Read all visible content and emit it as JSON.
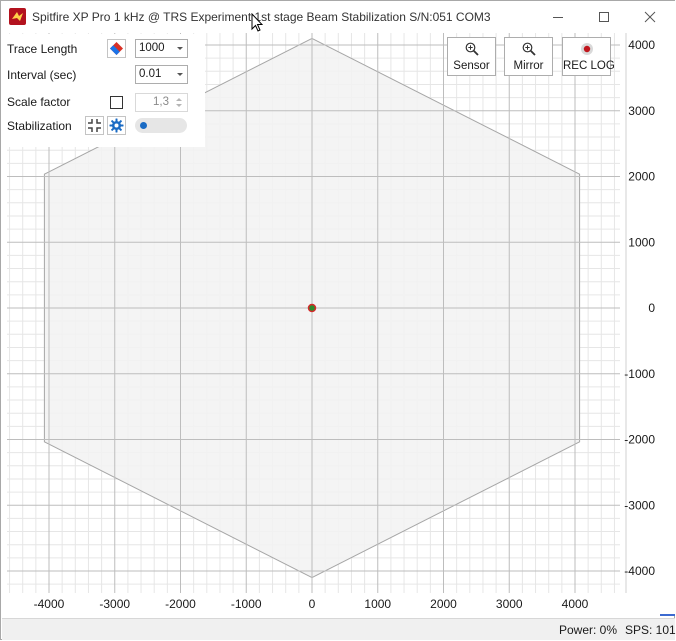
{
  "window": {
    "title": "Spitfire XP Pro 1 kHz @ TRS Experiment 1st stage Beam Stabilization  S/N:051  COM3",
    "app_icon": "spitfire-logo-icon",
    "buttons": {
      "minimize": "minimize-icon",
      "maximize": "maximize-icon",
      "close": "close-icon"
    }
  },
  "controls": {
    "trace_length": {
      "label": "Trace Length",
      "value": "1000",
      "icon": "clear-trace-eraser-icon"
    },
    "interval": {
      "label": "Interval (sec)",
      "value": "0.01"
    },
    "scale_factor": {
      "label": "Scale factor",
      "checked": false,
      "value": "1,3"
    },
    "stabilization": {
      "label": "Stabilization",
      "enabled": false,
      "icons": [
        "center-target-icon",
        "gear-icon"
      ]
    }
  },
  "toolbar": {
    "sensor": {
      "label": "Sensor",
      "icon": "zoom-in-icon"
    },
    "mirror": {
      "label": "Mirror",
      "icon": "zoom-in-icon"
    },
    "rec_log": {
      "label": "REC LOG",
      "icon": "record-icon"
    }
  },
  "status": {
    "power": "Power: 0%",
    "sps": "SPS: 101"
  },
  "colors": {
    "accent": "#1a6bc4",
    "hexagon_fill": "#f2f2f2",
    "point": "#2e8b2e",
    "point_outline": "#d42a2a",
    "app_icon": "#b3121e"
  },
  "chart_data": {
    "type": "scatter",
    "title": "",
    "xlabel": "",
    "ylabel": "",
    "xlim": [
      -4700,
      4700
    ],
    "ylim": [
      -4100,
      4100
    ],
    "x_ticks": [
      -4000,
      -3000,
      -2000,
      -1000,
      0,
      1000,
      2000,
      3000,
      4000
    ],
    "y_ticks": [
      4000,
      3000,
      2000,
      1000,
      0,
      -1000,
      -2000,
      -3000,
      -4000
    ],
    "y_axis_side": "right",
    "grid": true,
    "hexagon_vertices": [
      [
        0,
        4100
      ],
      [
        4070,
        2035
      ],
      [
        4070,
        -2035
      ],
      [
        0,
        -4100
      ],
      [
        -4070,
        -2035
      ],
      [
        -4070,
        2035
      ]
    ],
    "points": [
      {
        "x": 0,
        "y": 0
      }
    ]
  }
}
